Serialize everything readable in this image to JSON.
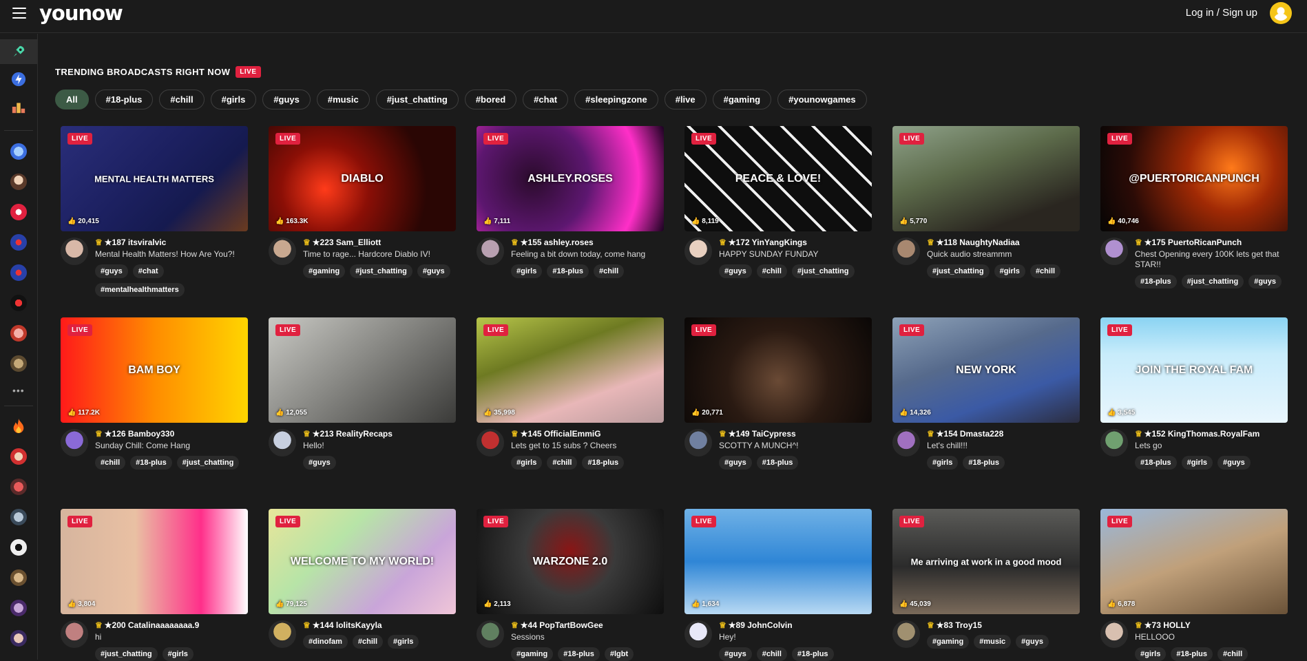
{
  "app": {
    "logo": "younow",
    "login_label": "Log in / Sign up"
  },
  "page": {
    "heading": "TRENDING BROADCASTS RIGHT NOW",
    "live_badge": "LIVE",
    "filters": [
      "All",
      "#18-plus",
      "#chill",
      "#girls",
      "#guys",
      "#music",
      "#just_chatting",
      "#bored",
      "#chat",
      "#sleepingzone",
      "#live",
      "#gaming",
      "#younowgames"
    ]
  },
  "sidebar": {
    "icons": [
      "rocket-icon",
      "lightning-icon",
      "leaderboard-icon",
      "globe-icon",
      "flame-icon",
      "more-dots-icon"
    ]
  },
  "colors": {
    "live": "#e0213f",
    "accent_chip": "#3c5a45",
    "background": "#1b1b1b",
    "crown": "#f5c518"
  },
  "cards": [
    {
      "likes": "20,415",
      "level": "★187",
      "name": "itsviralvic",
      "caption": "Mental Health Matters! How Are You?!",
      "tags": [
        "#guys",
        "#chat",
        "#mentalhealthmatters"
      ],
      "thumb_text": "MENTAL HEALTH MATTERS"
    },
    {
      "likes": "163.3K",
      "level": "★223",
      "name": "Sam_Elliott",
      "caption": "Time to rage... Hardcore Diablo IV!",
      "tags": [
        "#gaming",
        "#just_chatting",
        "#guys"
      ],
      "thumb_text": "DIABLO"
    },
    {
      "likes": "7,111",
      "level": "★155",
      "name": "ashley.roses",
      "caption": "Feeling a bit down today, come hang",
      "tags": [
        "#girls",
        "#18-plus",
        "#chill"
      ],
      "thumb_text": "ASHLEY.ROSES"
    },
    {
      "likes": "8,119",
      "level": "★172",
      "name": "YinYangKings",
      "caption": "HAPPY SUNDAY FUNDAY",
      "tags": [
        "#guys",
        "#chill",
        "#just_chatting"
      ],
      "thumb_text": "PEACE & LOVE!"
    },
    {
      "likes": "5,770",
      "level": "★118",
      "name": "NaughtyNadiaa",
      "caption": "Quick audio streammm",
      "tags": [
        "#just_chatting",
        "#girls",
        "#chill"
      ],
      "thumb_text": ""
    },
    {
      "likes": "40,746",
      "level": "★175",
      "name": "PuertoRicanPunch",
      "caption": "Chest Opening every 100K lets get that STAR!!",
      "tags": [
        "#18-plus",
        "#just_chatting",
        "#guys"
      ],
      "thumb_text": "@PUERTORICANPUNCH"
    },
    {
      "likes": "117.2K",
      "level": "★126",
      "name": "Bamboy330",
      "caption": "Sunday Chill: Come Hang",
      "tags": [
        "#chill",
        "#18-plus",
        "#just_chatting"
      ],
      "thumb_text": "BAM BOY"
    },
    {
      "likes": "12,055",
      "level": "★213",
      "name": "RealityRecaps",
      "caption": "Hello!",
      "tags": [
        "#guys"
      ],
      "thumb_text": ""
    },
    {
      "likes": "35,998",
      "level": "★145",
      "name": "OfficialEmmiG",
      "caption": "Lets get to 15 subs ? Cheers",
      "tags": [
        "#girls",
        "#chill",
        "#18-plus"
      ],
      "thumb_text": ""
    },
    {
      "likes": "20,771",
      "level": "★149",
      "name": "TaiCypress",
      "caption": "SCOTTY A MUNCH^!",
      "tags": [
        "#guys",
        "#18-plus"
      ],
      "thumb_text": ""
    },
    {
      "likes": "14,326",
      "level": "★154",
      "name": "Dmasta228",
      "caption": "Let's chill!!!",
      "tags": [
        "#girls",
        "#18-plus"
      ],
      "thumb_text": "NEW YORK"
    },
    {
      "likes": "3,545",
      "level": "★152",
      "name": "KingThomas.RoyalFam",
      "caption": "Lets go",
      "tags": [
        "#18-plus",
        "#girls",
        "#guys"
      ],
      "thumb_text": "JOIN THE ROYAL FAM"
    },
    {
      "likes": "3,804",
      "level": "★200",
      "name": "Catalinaaaaaaaa.9",
      "caption": "hi",
      "tags": [
        "#just_chatting",
        "#girls"
      ],
      "thumb_text": ""
    },
    {
      "likes": "79,125",
      "level": "★144",
      "name": "lolitsKayyla",
      "caption": "",
      "tags": [
        "#dinofam",
        "#chill",
        "#girls"
      ],
      "thumb_text": "WELCOME TO MY WORLD!"
    },
    {
      "likes": "2,113",
      "level": "★44",
      "name": "PopTartBowGee",
      "caption": "Sessions",
      "tags": [
        "#gaming",
        "#18-plus",
        "#lgbt"
      ],
      "thumb_text": "WARZONE 2.0"
    },
    {
      "likes": "1,634",
      "level": "★89",
      "name": "JohnColvin",
      "caption": "Hey!",
      "tags": [
        "#guys",
        "#chill",
        "#18-plus"
      ],
      "thumb_text": ""
    },
    {
      "likes": "45,039",
      "level": "★83",
      "name": "Troy15",
      "caption": "",
      "tags": [
        "#gaming",
        "#music",
        "#guys"
      ],
      "thumb_text": "Me arriving at work in a good mood"
    },
    {
      "likes": "6,878",
      "level": "★73",
      "name": "HOLLY",
      "caption": "HELLOOO",
      "tags": [
        "#girls",
        "#18-plus",
        "#chill"
      ],
      "thumb_text": ""
    }
  ]
}
